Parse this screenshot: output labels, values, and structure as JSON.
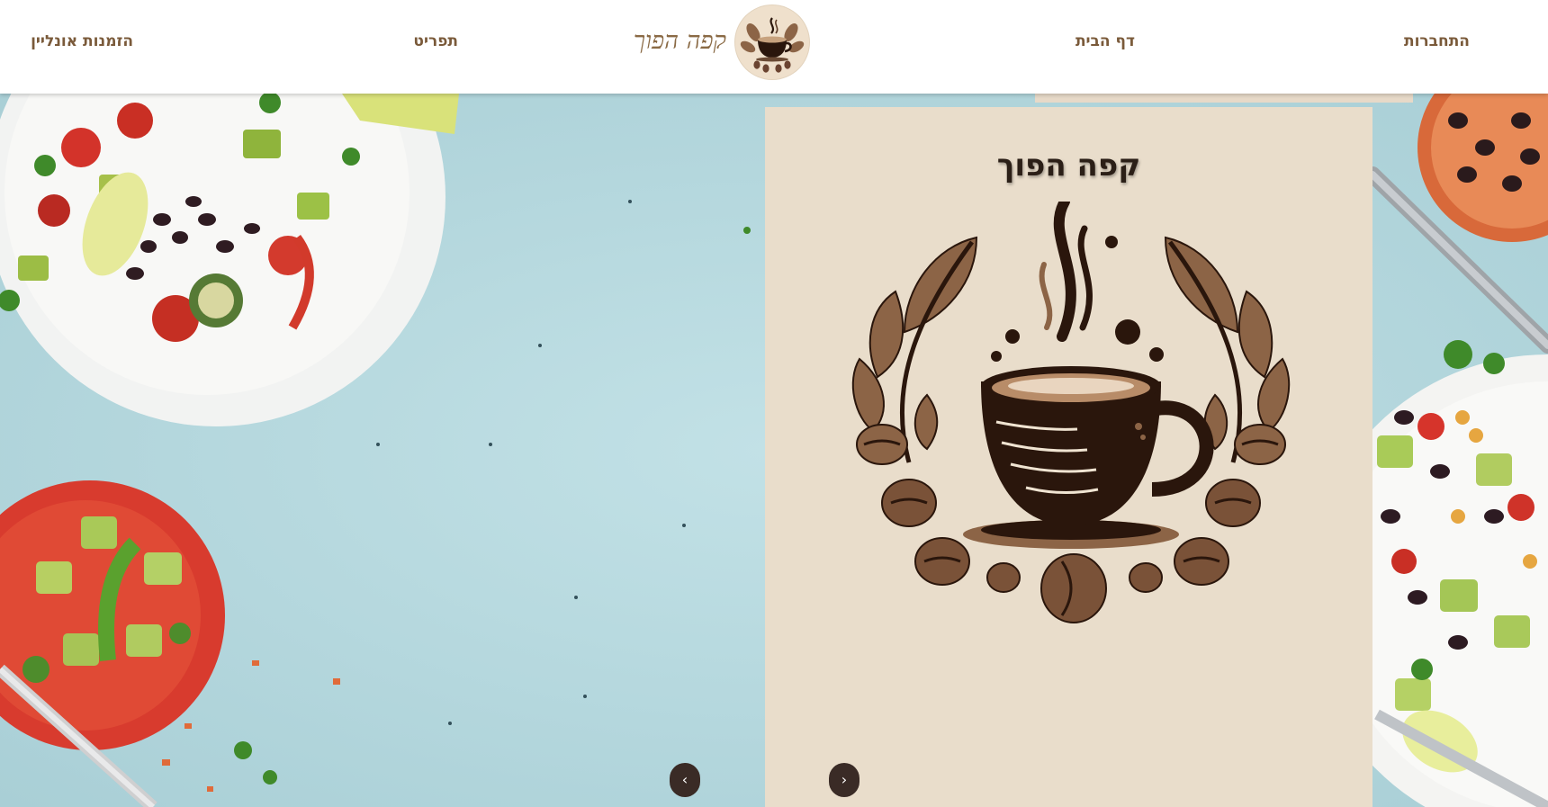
{
  "header": {
    "brand_name": "קפה הפוך",
    "nav": {
      "login": "התחברות",
      "home": "דף הבית",
      "menu": "תפריט",
      "online_orders": "הזמנות אונליין"
    }
  },
  "hero": {
    "card_title": "קפה הפוך",
    "prev_arrow": "‹",
    "next_arrow": "›"
  },
  "colors": {
    "nav_text": "#7a5a3a",
    "card_bg": "#e9ddcb",
    "cup": "#2a160c",
    "leaf": "#8c6446",
    "hero_bg": "#b6d8de",
    "arrow_bg": "#3a2b26"
  },
  "icons": [
    "coffee-cup-logo-icon",
    "chevron-left-icon",
    "chevron-right-icon"
  ]
}
